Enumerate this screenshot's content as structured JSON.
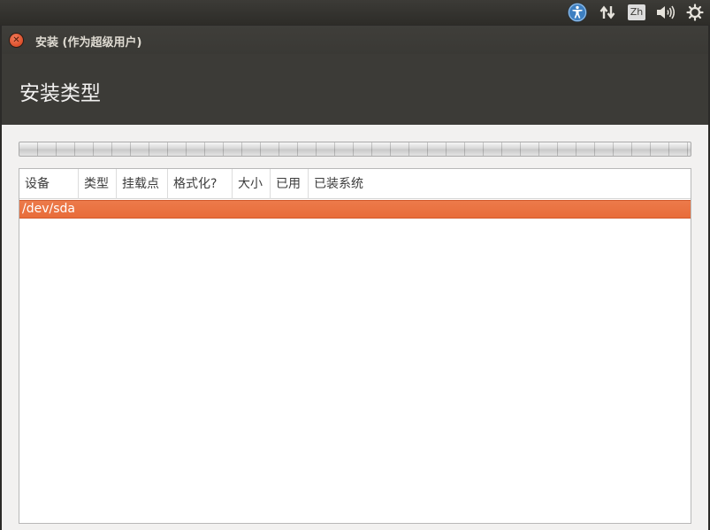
{
  "top_panel": {
    "accessibility_icon": "accessibility-icon",
    "network_icon": "network-arrows-icon",
    "language": "Zh",
    "sound_icon": "speaker-icon",
    "system_icon": "gear-icon"
  },
  "window": {
    "title": "安装 (作为超级用户)",
    "close_icon": "close-icon"
  },
  "page": {
    "title": "安装类型"
  },
  "partition_table": {
    "columns": [
      "设备",
      "类型",
      "挂载点",
      "格式化?",
      "大小",
      "已用",
      "已装系统"
    ],
    "rows": [
      {
        "device": "/dev/sda",
        "selected": true
      }
    ]
  },
  "colors": {
    "selection": "#e86c3a",
    "header_dark": "#3c3b37",
    "window_bg": "#f2f1f0"
  }
}
